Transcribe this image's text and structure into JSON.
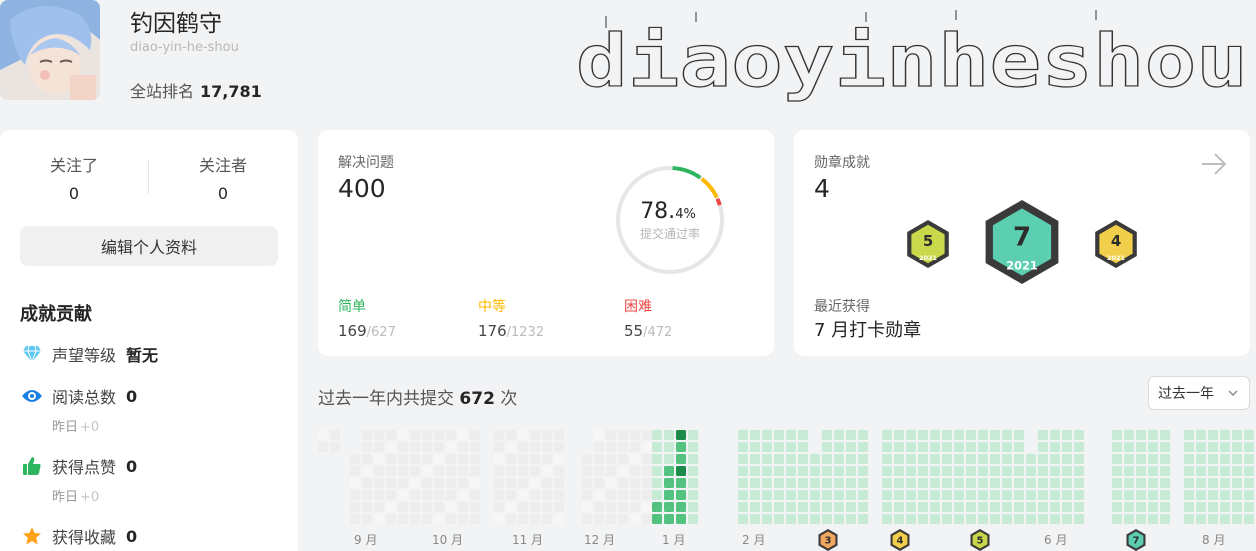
{
  "profile": {
    "name": "钓因鹤守",
    "slug": "diao-yin-he-shou",
    "rank_label": "全站排名",
    "rank_value": "17,781",
    "ascii_banner": "diaoyinheshou"
  },
  "follow": {
    "following_label": "关注了",
    "following_value": "0",
    "followers_label": "关注者",
    "followers_value": "0",
    "edit_label": "编辑个人资料"
  },
  "contributions": {
    "title": "成就贡献",
    "reputation_label": "声望等级",
    "reputation_value": "暂无",
    "reads_label": "阅读总数",
    "reads_value": "0",
    "reads_sub_label": "昨日",
    "reads_sub_delta": "+0",
    "likes_label": "获得点赞",
    "likes_value": "0",
    "likes_sub_label": "昨日",
    "likes_sub_delta": "+0",
    "favs_label": "获得收藏",
    "favs_value": "0"
  },
  "solved": {
    "label": "解决问题",
    "value": "400",
    "rate_int": "78.",
    "rate_dec": "4%",
    "rate_label": "提交通过率",
    "rate_fraction": 0.784,
    "easy_label": "简单",
    "easy_solved": "169",
    "easy_total": "/627",
    "medium_label": "中等",
    "medium_solved": "176",
    "medium_total": "/1232",
    "hard_label": "困难",
    "hard_solved": "55",
    "hard_total": "/472",
    "colors": {
      "easy": "#2db55d",
      "medium": "#ffb800",
      "hard": "#ef4743"
    }
  },
  "badges": {
    "label": "勋章成就",
    "value": "4",
    "items": [
      {
        "num": "5",
        "year": "2021",
        "color": "#c8d84a"
      },
      {
        "num": "7",
        "year": "2021",
        "color": "#5ccfb0"
      },
      {
        "num": "4",
        "year": "2021",
        "color": "#f2cf4a"
      }
    ],
    "recent_label": "最近获得",
    "recent_value": "7 月打卡勋章"
  },
  "submissions": {
    "prefix": "过去一年内共提交",
    "count": "672",
    "suffix": "次",
    "range_label": "过去一年",
    "months": [
      "9 月",
      "10 月",
      "11 月",
      "12 月",
      "1 月",
      "2 月",
      "6 月",
      "8 月"
    ],
    "mini_badges": [
      {
        "num": "3",
        "color": "#f0a860"
      },
      {
        "num": "4",
        "color": "#f2cf4a"
      },
      {
        "num": "5",
        "color": "#c8d84a"
      },
      {
        "num": "7",
        "color": "#5ccfb0"
      }
    ]
  }
}
